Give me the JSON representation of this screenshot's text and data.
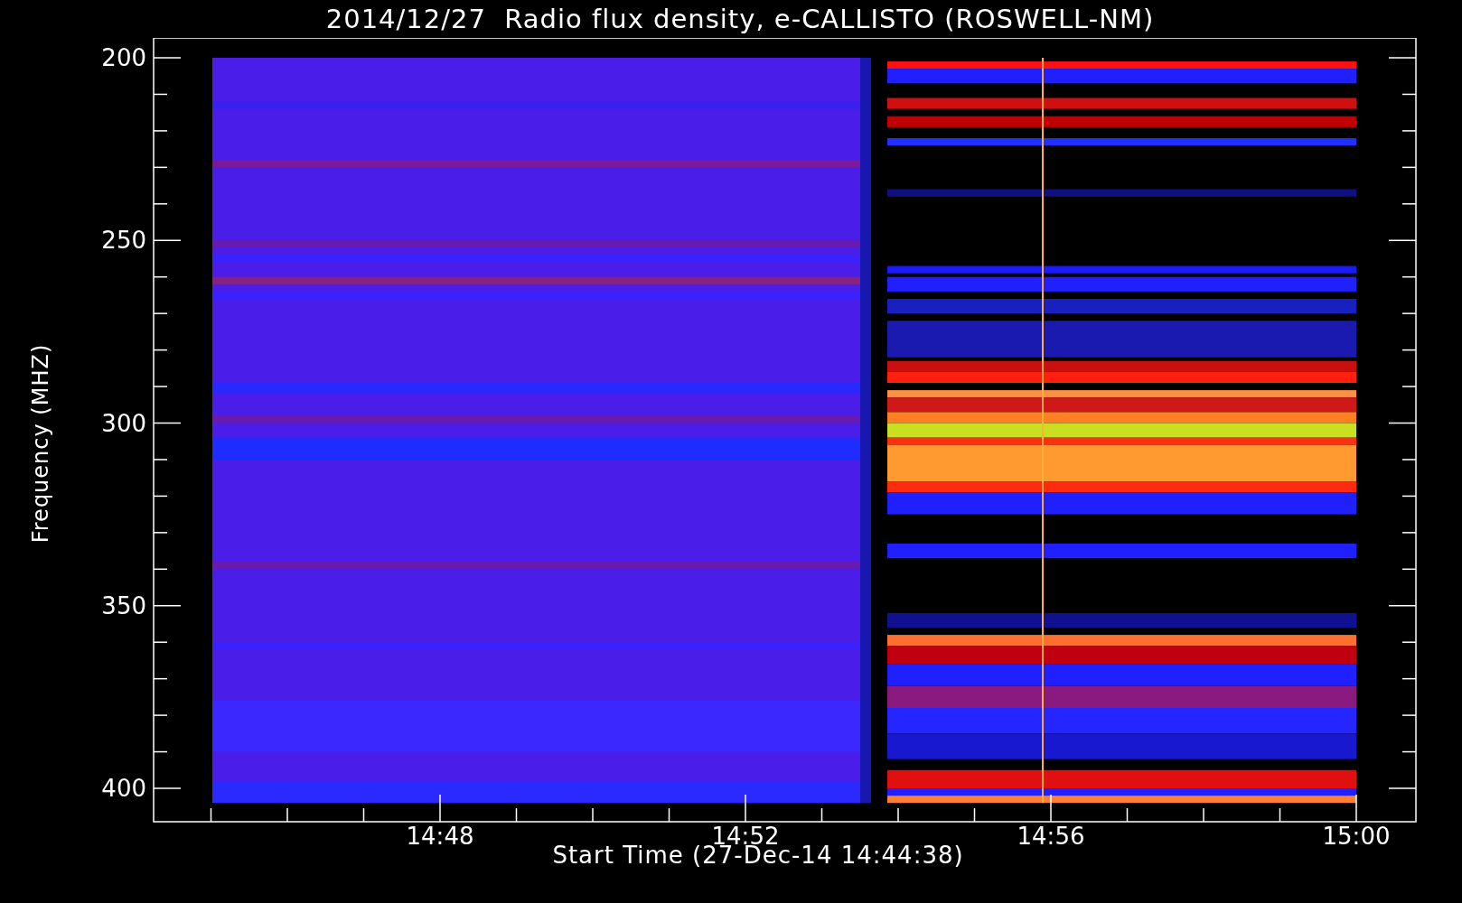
{
  "title": "2014/12/27  Radio flux density, e-CALLISTO (ROSWELL-NM)",
  "y_axis": {
    "label": "Frequency (MHZ)",
    "ticks": [
      "200",
      "250",
      "300",
      "350",
      "400"
    ]
  },
  "x_axis": {
    "label": "Start Time (27-Dec-14 14:44:38)",
    "ticks": [
      "14:48",
      "14:52",
      "14:56",
      "15:00"
    ]
  }
}
